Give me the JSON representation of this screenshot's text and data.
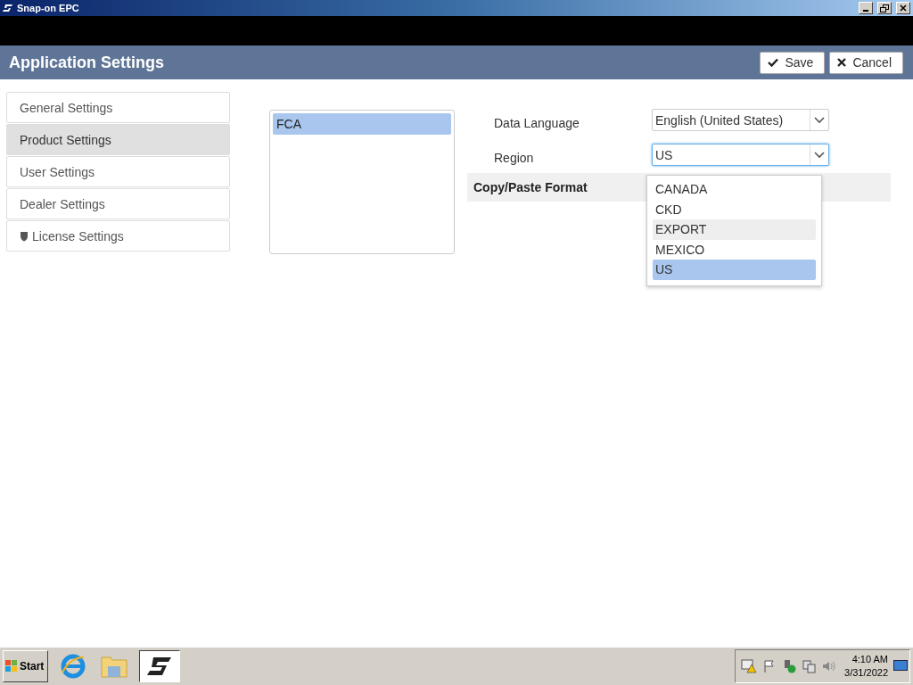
{
  "window": {
    "title": "Snap-on EPC"
  },
  "header": {
    "title": "Application Settings",
    "buttons": [
      {
        "kind": "save",
        "label": "Save"
      },
      {
        "kind": "cancel",
        "label": "Cancel"
      }
    ]
  },
  "sidebar": {
    "items": [
      {
        "label": "General Settings",
        "selected": false,
        "kind": "plain"
      },
      {
        "label": "Product Settings",
        "selected": true,
        "kind": "plain"
      },
      {
        "label": "User Settings",
        "selected": false,
        "kind": "plain"
      },
      {
        "label": "Dealer Settings",
        "selected": false,
        "kind": "plain"
      },
      {
        "label": "License Settings",
        "selected": false,
        "kind": "shield"
      }
    ]
  },
  "products": [
    {
      "label": "FCA",
      "selected": true
    }
  ],
  "form": {
    "fields": [
      {
        "label": "Data Language",
        "value": "English (United States)",
        "focused": false
      },
      {
        "label": "Region",
        "value": "US",
        "focused": true
      }
    ],
    "section": "Copy/Paste Format",
    "dropdown": [
      {
        "label": "CANADA",
        "selected": false,
        "hovered": false
      },
      {
        "label": "CKD",
        "selected": false,
        "hovered": false
      },
      {
        "label": "EXPORT",
        "selected": false,
        "hovered": true
      },
      {
        "label": "MEXICO",
        "selected": false,
        "hovered": false
      },
      {
        "label": "US",
        "selected": true,
        "hovered": false
      }
    ]
  },
  "taskbar": {
    "start": "Start",
    "time": "4:10 AM",
    "date": "3/31/2022"
  }
}
